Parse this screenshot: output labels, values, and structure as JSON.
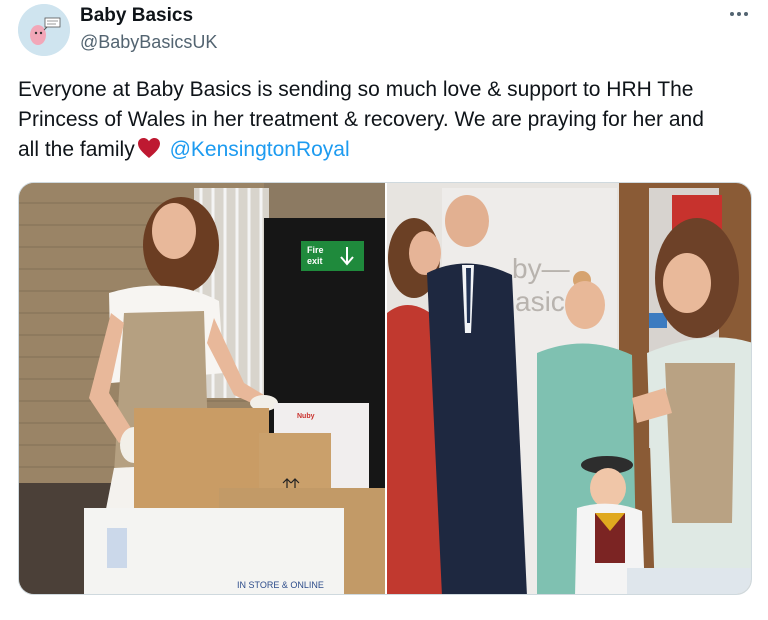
{
  "author": {
    "name": "Baby Basics",
    "handle": "@BabyBasicsUK",
    "avatar_icon": "baby-basics-logo-icon"
  },
  "tweet": {
    "line1": "Everyone at Baby Basics is sending so much love & support to HRH The",
    "line2": "Princess of Wales in her treatment & recovery. We are praying for her and",
    "line3_before_emoji": "all the family",
    "emoji": "heart-icon",
    "mention": "@KensingtonRoyal"
  },
  "media": {
    "left_photo": {
      "sign_text_1": "Fire",
      "sign_text_2": "exit",
      "box_text": "IN STORE & ONLINE",
      "box_brand": "Nuby"
    },
    "right_photo": {
      "wall_text_1": "by—",
      "wall_text_2": "asic"
    }
  },
  "colors": {
    "text": "#0f1419",
    "secondary": "#536471",
    "link": "#1d9bf0",
    "heart": "#be1931"
  }
}
